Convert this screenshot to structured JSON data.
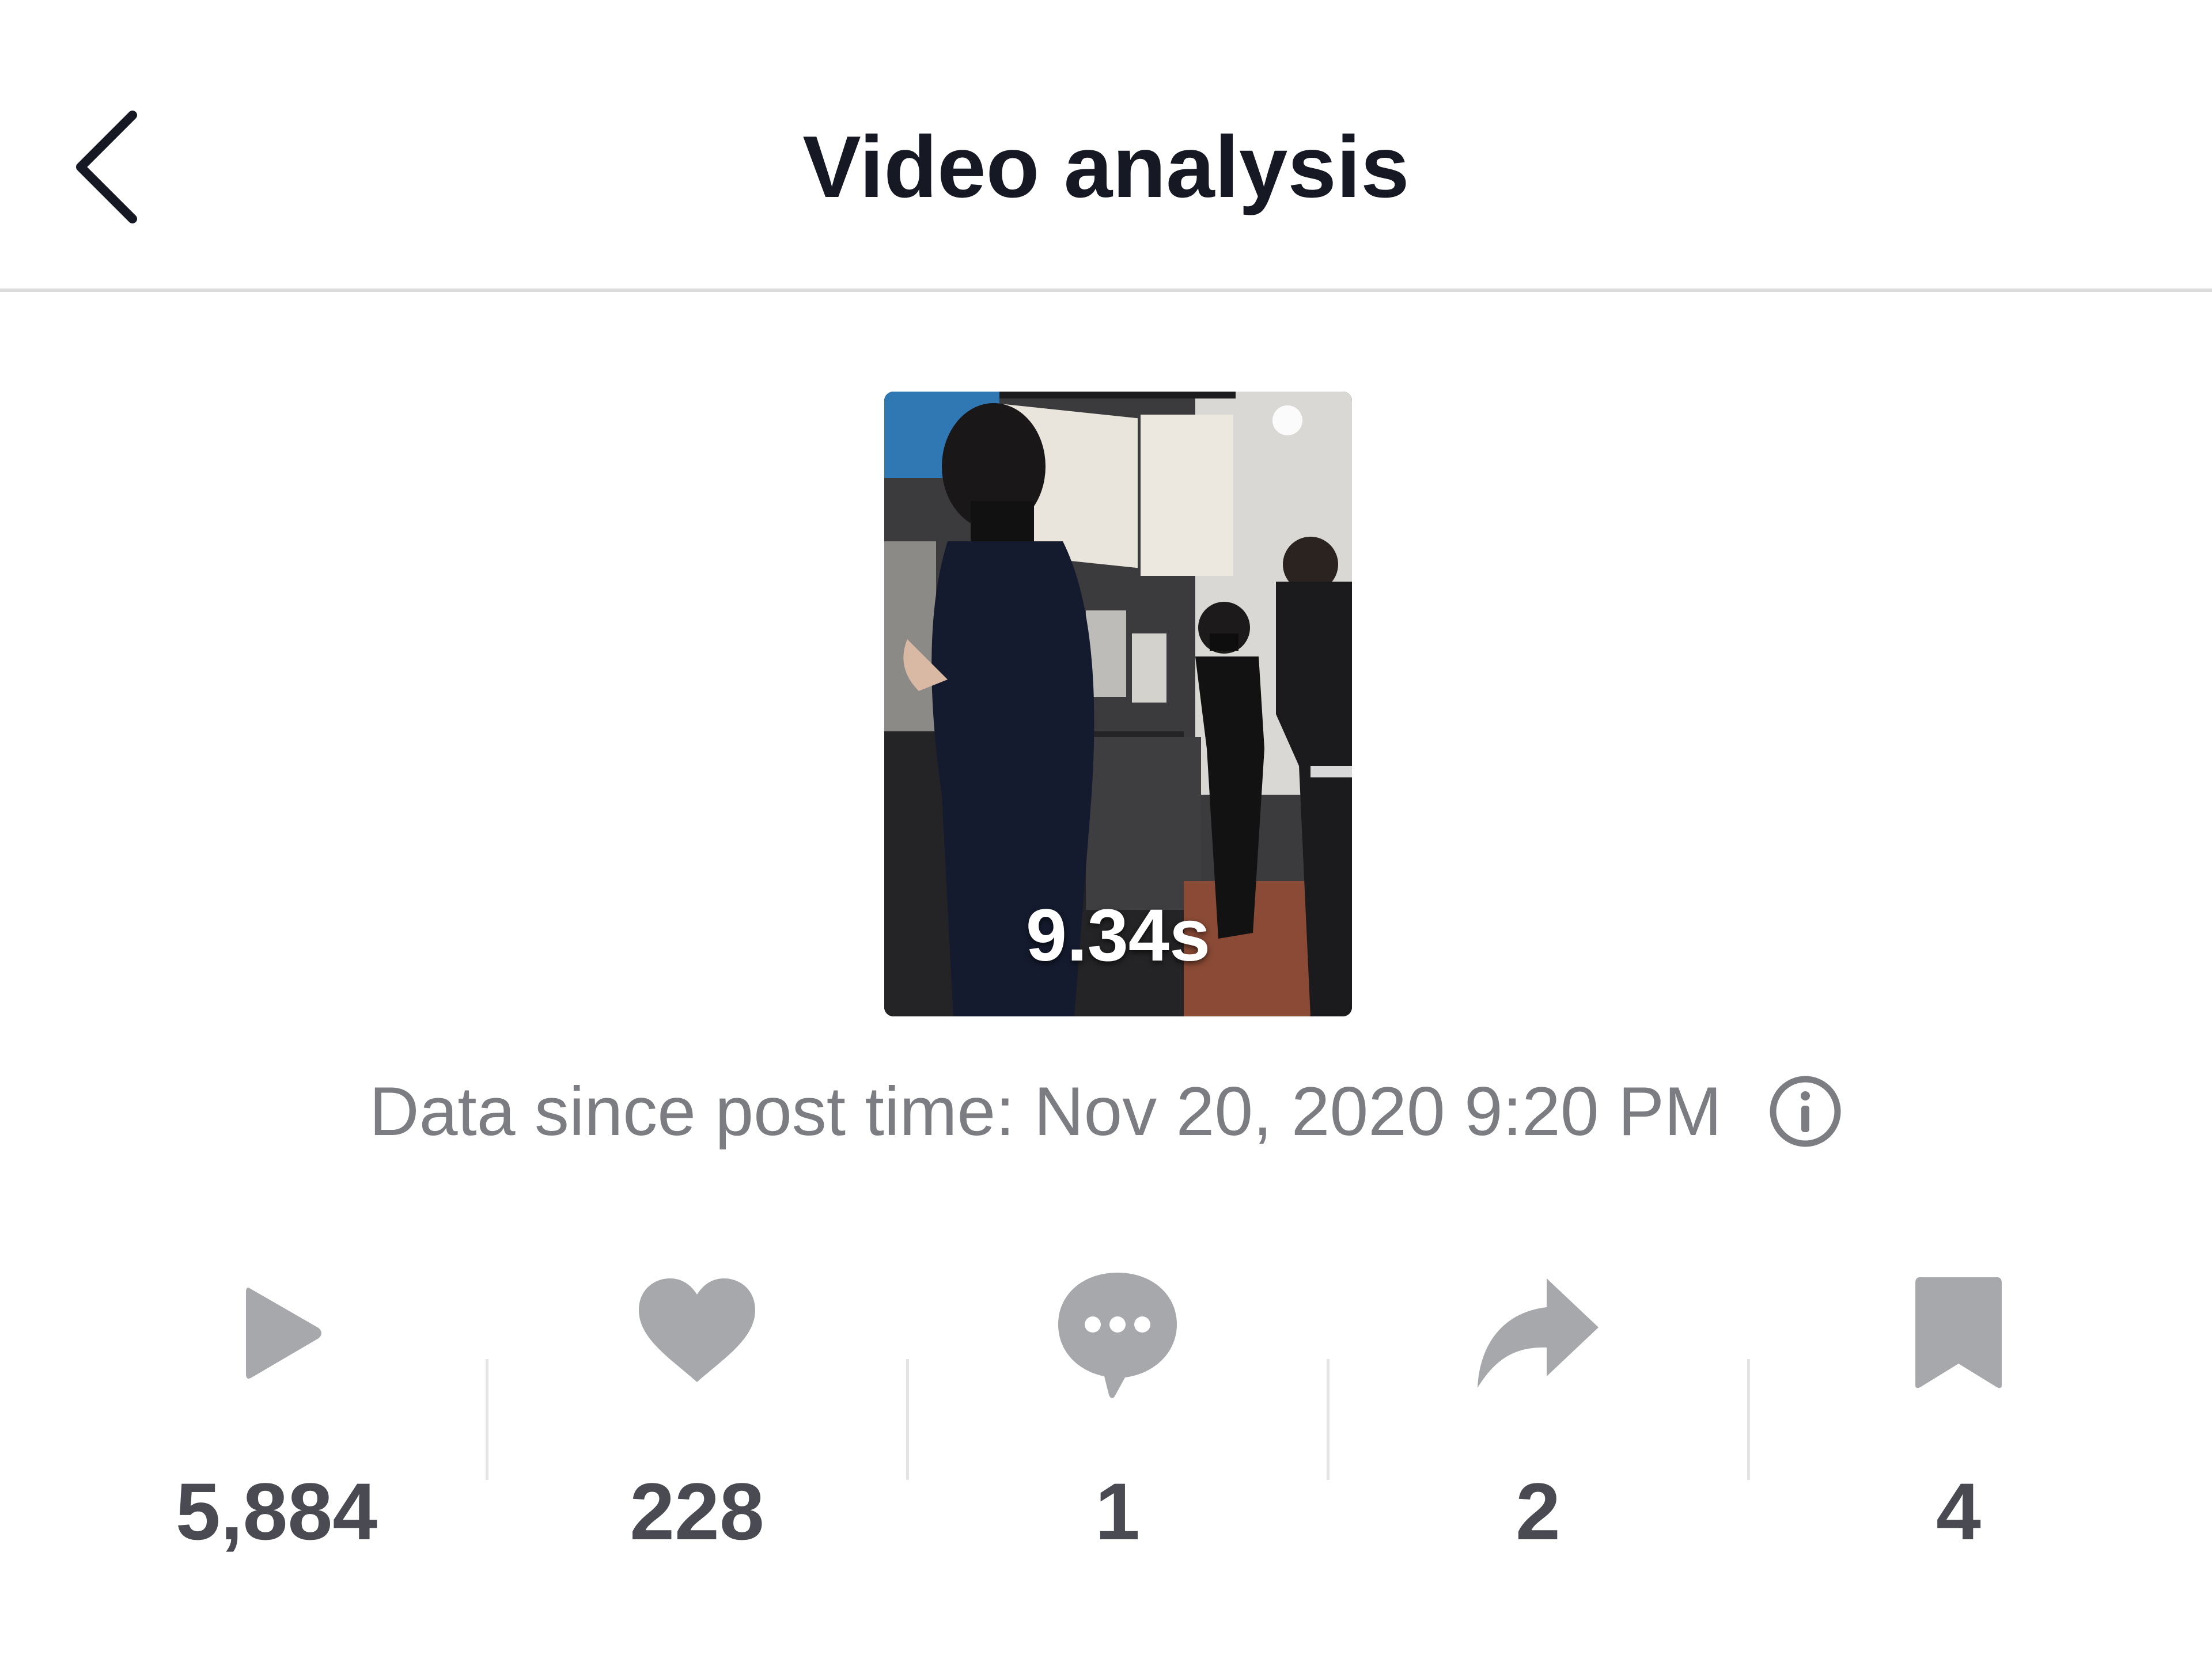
{
  "header": {
    "title": "Video analysis",
    "back_icon": "chevron-left-icon"
  },
  "video": {
    "duration": "9.34s"
  },
  "post_info": {
    "since_text": "Data since post time: Nov 20, 2020 9:20 PM",
    "info_icon": "info-circle-icon"
  },
  "stats": [
    {
      "icon": "play-icon",
      "value": "5,884"
    },
    {
      "icon": "heart-icon",
      "value": "228"
    },
    {
      "icon": "comment-icon",
      "value": "1"
    },
    {
      "icon": "share-icon",
      "value": "2"
    },
    {
      "icon": "bookmark-icon",
      "value": "4"
    }
  ],
  "colors": {
    "title": "#161823",
    "secondary_text": "#7c7d82",
    "icon_gray": "#a7a8ac",
    "value_text": "#4a4b52",
    "divider": "#dcdcdf"
  }
}
